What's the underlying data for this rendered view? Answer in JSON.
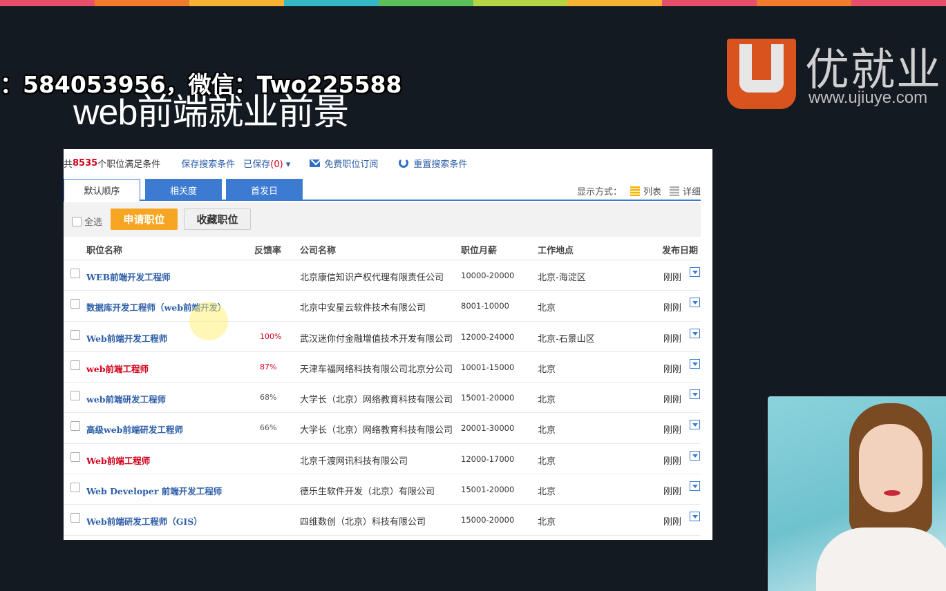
{
  "colors": {
    "strip": [
      "#e84f6b",
      "#ef7d2d",
      "#f9b233",
      "#35b8c6",
      "#5bbf5a",
      "#b4d645",
      "#f9b233",
      "#e84f6b",
      "#ef7d2d",
      "#e84f6b"
    ],
    "accent_blue": "#3c7bd1",
    "apply_orange": "#f6a623",
    "highlight_red": "#d0021b",
    "logo_orange": "#d9531e"
  },
  "overlay": {
    "contact_line": "：584053956，微信：Two225588",
    "slide_title": "web前端就业前景"
  },
  "logo": {
    "name": "优就业",
    "url": "www.ujiuye.com"
  },
  "search_bar": {
    "prefix": "共",
    "count": "8535",
    "suffix": "个职位满足条件",
    "save_search": "保存搜索条件",
    "saved_label": "已保存",
    "saved_count": "(0)",
    "subscribe": "免费职位订阅",
    "reset": "重置搜索条件"
  },
  "tabs": [
    {
      "label": "默认顺序"
    },
    {
      "label": "相关度"
    },
    {
      "label": "首发日"
    }
  ],
  "display_mode": {
    "label": "显示方式：",
    "list": "列表",
    "detail": "详细"
  },
  "actions": {
    "select_all": "全选",
    "apply": "申请职位",
    "favorite": "收藏职位"
  },
  "columns": {
    "title": "职位名称",
    "rate": "反馈率",
    "company": "公司名称",
    "salary": "职位月薪",
    "location": "工作地点",
    "date": "发布日期"
  },
  "jobs": [
    {
      "title": "WEB前端开发工程师",
      "rate": "",
      "company": "北京康信知识产权代理有限责任公司",
      "salary": "10000-20000",
      "location": "北京-海淀区",
      "date": "刚刚",
      "hot": false
    },
    {
      "title": "数据库开发工程师（web前端开发）",
      "rate": "",
      "company": "北京中安星云软件技术有限公司",
      "salary": "8001-10000",
      "location": "北京",
      "date": "刚刚",
      "hot": false
    },
    {
      "title": "Web前端开发工程师",
      "rate": "100%",
      "company": "武汉迷你付金融增值技术开发有限公司",
      "salary": "12000-24000",
      "location": "北京-石景山区",
      "date": "刚刚",
      "hot": false,
      "rate_hot": true
    },
    {
      "title": "web前端工程师",
      "rate": "87%",
      "company": "天津车福网络科技有限公司北京分公司",
      "salary": "10001-15000",
      "location": "北京",
      "date": "刚刚",
      "hot": true,
      "rate_hot": true
    },
    {
      "title": "web前端研发工程师",
      "rate": "68%",
      "company": "大学长（北京）网络教育科技有限公司",
      "salary": "15001-20000",
      "location": "北京",
      "date": "刚刚",
      "hot": false
    },
    {
      "title": "高级web前端研发工程师",
      "rate": "66%",
      "company": "大学长（北京）网络教育科技有限公司",
      "salary": "20001-30000",
      "location": "北京",
      "date": "刚刚",
      "hot": false
    },
    {
      "title": "Web前端工程师",
      "rate": "",
      "company": "北京千渡网讯科技有限公司",
      "salary": "12000-17000",
      "location": "北京",
      "date": "刚刚",
      "hot": true
    },
    {
      "title": "Web Developer 前端开发工程师",
      "rate": "",
      "company": "德乐生软件开发（北京）有限公司",
      "salary": "15001-20000",
      "location": "北京",
      "date": "刚刚",
      "hot": false
    },
    {
      "title": "Web前端研发工程师（GIS）",
      "rate": "",
      "company": "四维数创（北京）科技有限公司",
      "salary": "15000-20000",
      "location": "北京",
      "date": "刚刚",
      "hot": false
    }
  ]
}
